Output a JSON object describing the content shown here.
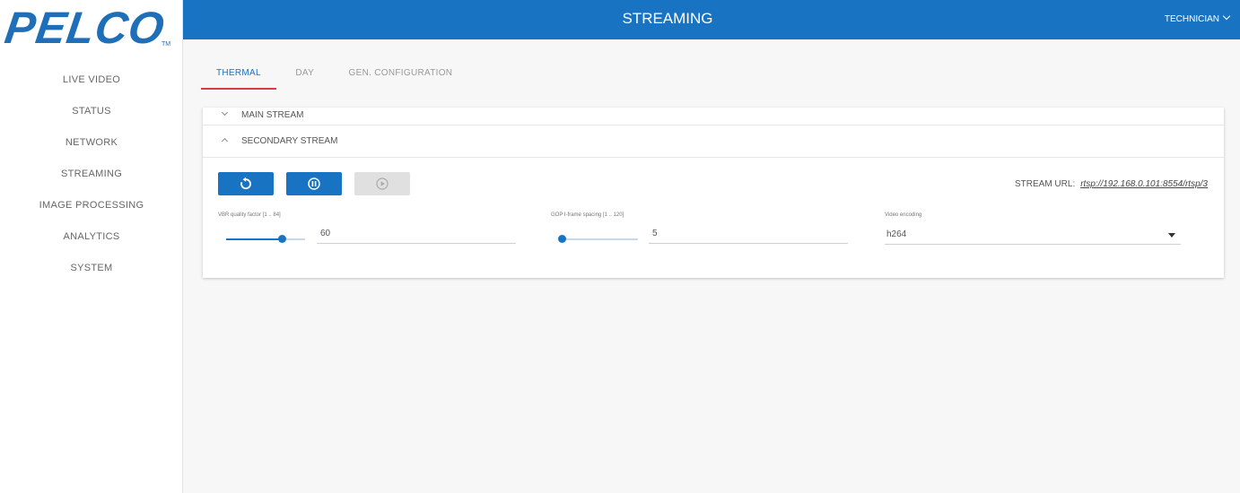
{
  "logo": {
    "text": "PELCO",
    "tm": "TM"
  },
  "sidebar": {
    "items": [
      {
        "label": "LIVE VIDEO"
      },
      {
        "label": "STATUS"
      },
      {
        "label": "NETWORK"
      },
      {
        "label": "STREAMING"
      },
      {
        "label": "IMAGE PROCESSING"
      },
      {
        "label": "ANALYTICS"
      },
      {
        "label": "SYSTEM"
      }
    ]
  },
  "header": {
    "title": "STREAMING",
    "user": "TECHNICIAN"
  },
  "tabs": [
    {
      "label": "THERMAL",
      "active": true
    },
    {
      "label": "DAY",
      "active": false
    },
    {
      "label": "GEN. CONFIGURATION",
      "active": false
    }
  ],
  "panel": {
    "main_stream": {
      "label": "MAIN STREAM",
      "expanded": false
    },
    "secondary_stream": {
      "label": "SECONDARY STREAM",
      "expanded": true
    },
    "buttons": {
      "reset_icon": "refresh-icon",
      "pause_icon": "pause-circle-icon",
      "play_icon": "play-circle-icon"
    },
    "stream_url": {
      "label": "STREAM URL:",
      "value": "rtsp://192.168.0.101:8554/rtsp/3"
    },
    "vbr": {
      "label": "VBR quality factor [1 .. 84]",
      "value": "60",
      "fraction": 0.71
    },
    "gop": {
      "label": "GOP I-frame spacing [1 .. 120]",
      "value": "5",
      "fraction": 0.03
    },
    "encoding": {
      "label": "Video encoding",
      "value": "h264"
    }
  },
  "colors": {
    "brand": "#1873c2",
    "tab_underline": "#d93a4a",
    "disabled": "#e0e0e0"
  }
}
